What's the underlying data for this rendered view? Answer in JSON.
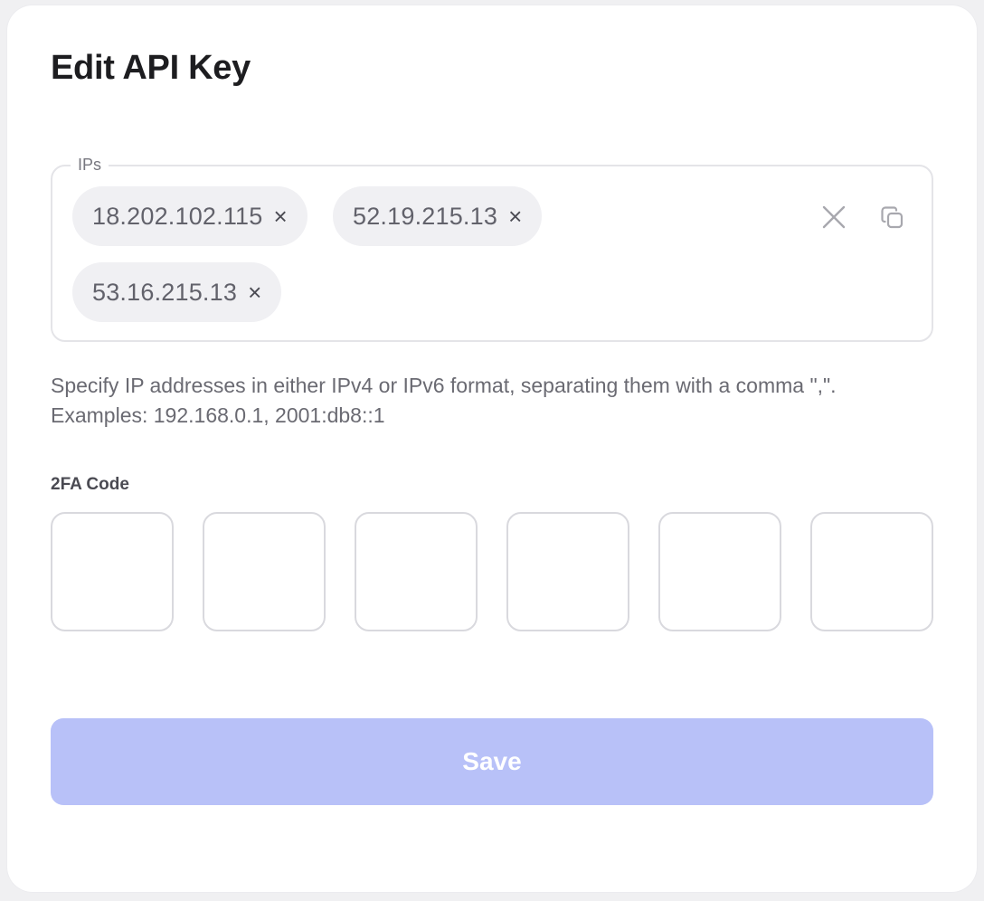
{
  "title": "Edit API Key",
  "ips": {
    "label": "IPs",
    "chips": [
      {
        "value": "18.202.102.115"
      },
      {
        "value": "52.19.215.13"
      },
      {
        "value": "53.16.215.13"
      }
    ],
    "remove_glyph": "×"
  },
  "help": {
    "line1": "Specify IP addresses in either IPv4 or IPv6 format, separating them with a comma \",\".",
    "line2": "Examples: 192.168.0.1, 2001:db8::1"
  },
  "twofa": {
    "label": "2FA Code",
    "digits": [
      "",
      "",
      "",
      "",
      "",
      ""
    ]
  },
  "save_label": "Save",
  "colors": {
    "accent_disabled": "#b8c1f8",
    "chip_bg": "#f0f0f3"
  },
  "icons": [
    "clear-all-icon",
    "copy-icon",
    "remove-chip-icon"
  ]
}
